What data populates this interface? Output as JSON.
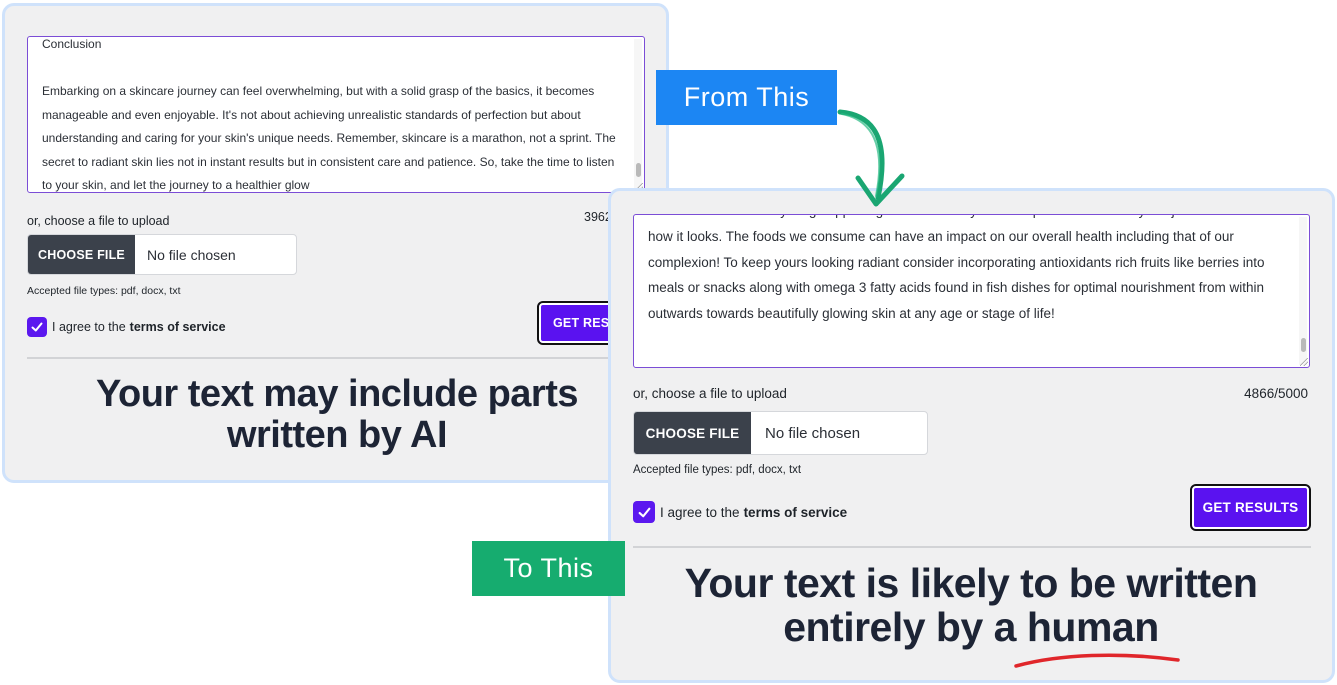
{
  "before": {
    "textarea_text": "Conclusion\n\nEmbarking on a skincare journey can feel overwhelming, but with a solid grasp of the basics, it becomes manageable and even enjoyable. It's not about achieving unrealistic standards of perfection but about understanding and caring for your skin's unique needs. Remember, skincare is a marathon, not a sprint. The secret to radiant skin lies not in instant results but in consistent care and patience. So, take the time to listen to your skin, and let the journey to a healthier glow",
    "upload_label": "or, choose a file to upload",
    "char_count": "3962",
    "choose_file_label": "CHOOSE FILE",
    "no_file_text": "No file chosen",
    "accepted_types": "Accepted file types: pdf, docx, txt",
    "agree_text": "I agree to the",
    "tos_text": "terms of service",
    "get_results_label": "GET RESU",
    "headline_line1": "Your text may include parts",
    "headline_line2": "written by AI"
  },
  "after": {
    "textarea_text": "Your skin reflects everything happening within the body so it's important to care beyond just\nhow it looks. The foods we consume can have an impact on our overall health including that of our complexion! To keep yours looking radiant consider incorporating antioxidants rich fruits like berries into meals or snacks along with omega 3 fatty acids found in fish dishes for optimal nourishment from within outwards towards beautifully glowing skin at any age or stage of life!",
    "upload_label": "or, choose a file to upload",
    "char_count": "4866/5000",
    "choose_file_label": "CHOOSE FILE",
    "no_file_text": "No file chosen",
    "accepted_types": "Accepted file types: pdf, docx, txt",
    "agree_text": "I agree to the",
    "tos_text": "terms of service",
    "get_results_label": "GET RESULTS",
    "headline_line1": "Your text is likely to be written",
    "headline_line2_pre": "entirely by a",
    "headline_line2_emph": "human"
  },
  "callouts": {
    "from": "From This",
    "to": "To This"
  },
  "colors": {
    "from_badge": "#1c86f3",
    "to_badge": "#16ac6f",
    "primary_button": "#5a12f0",
    "arrow": "#1aa672",
    "underline": "#e0262b"
  },
  "icons": {
    "checkbox": "check-icon",
    "arrow": "curved-arrow-icon"
  }
}
